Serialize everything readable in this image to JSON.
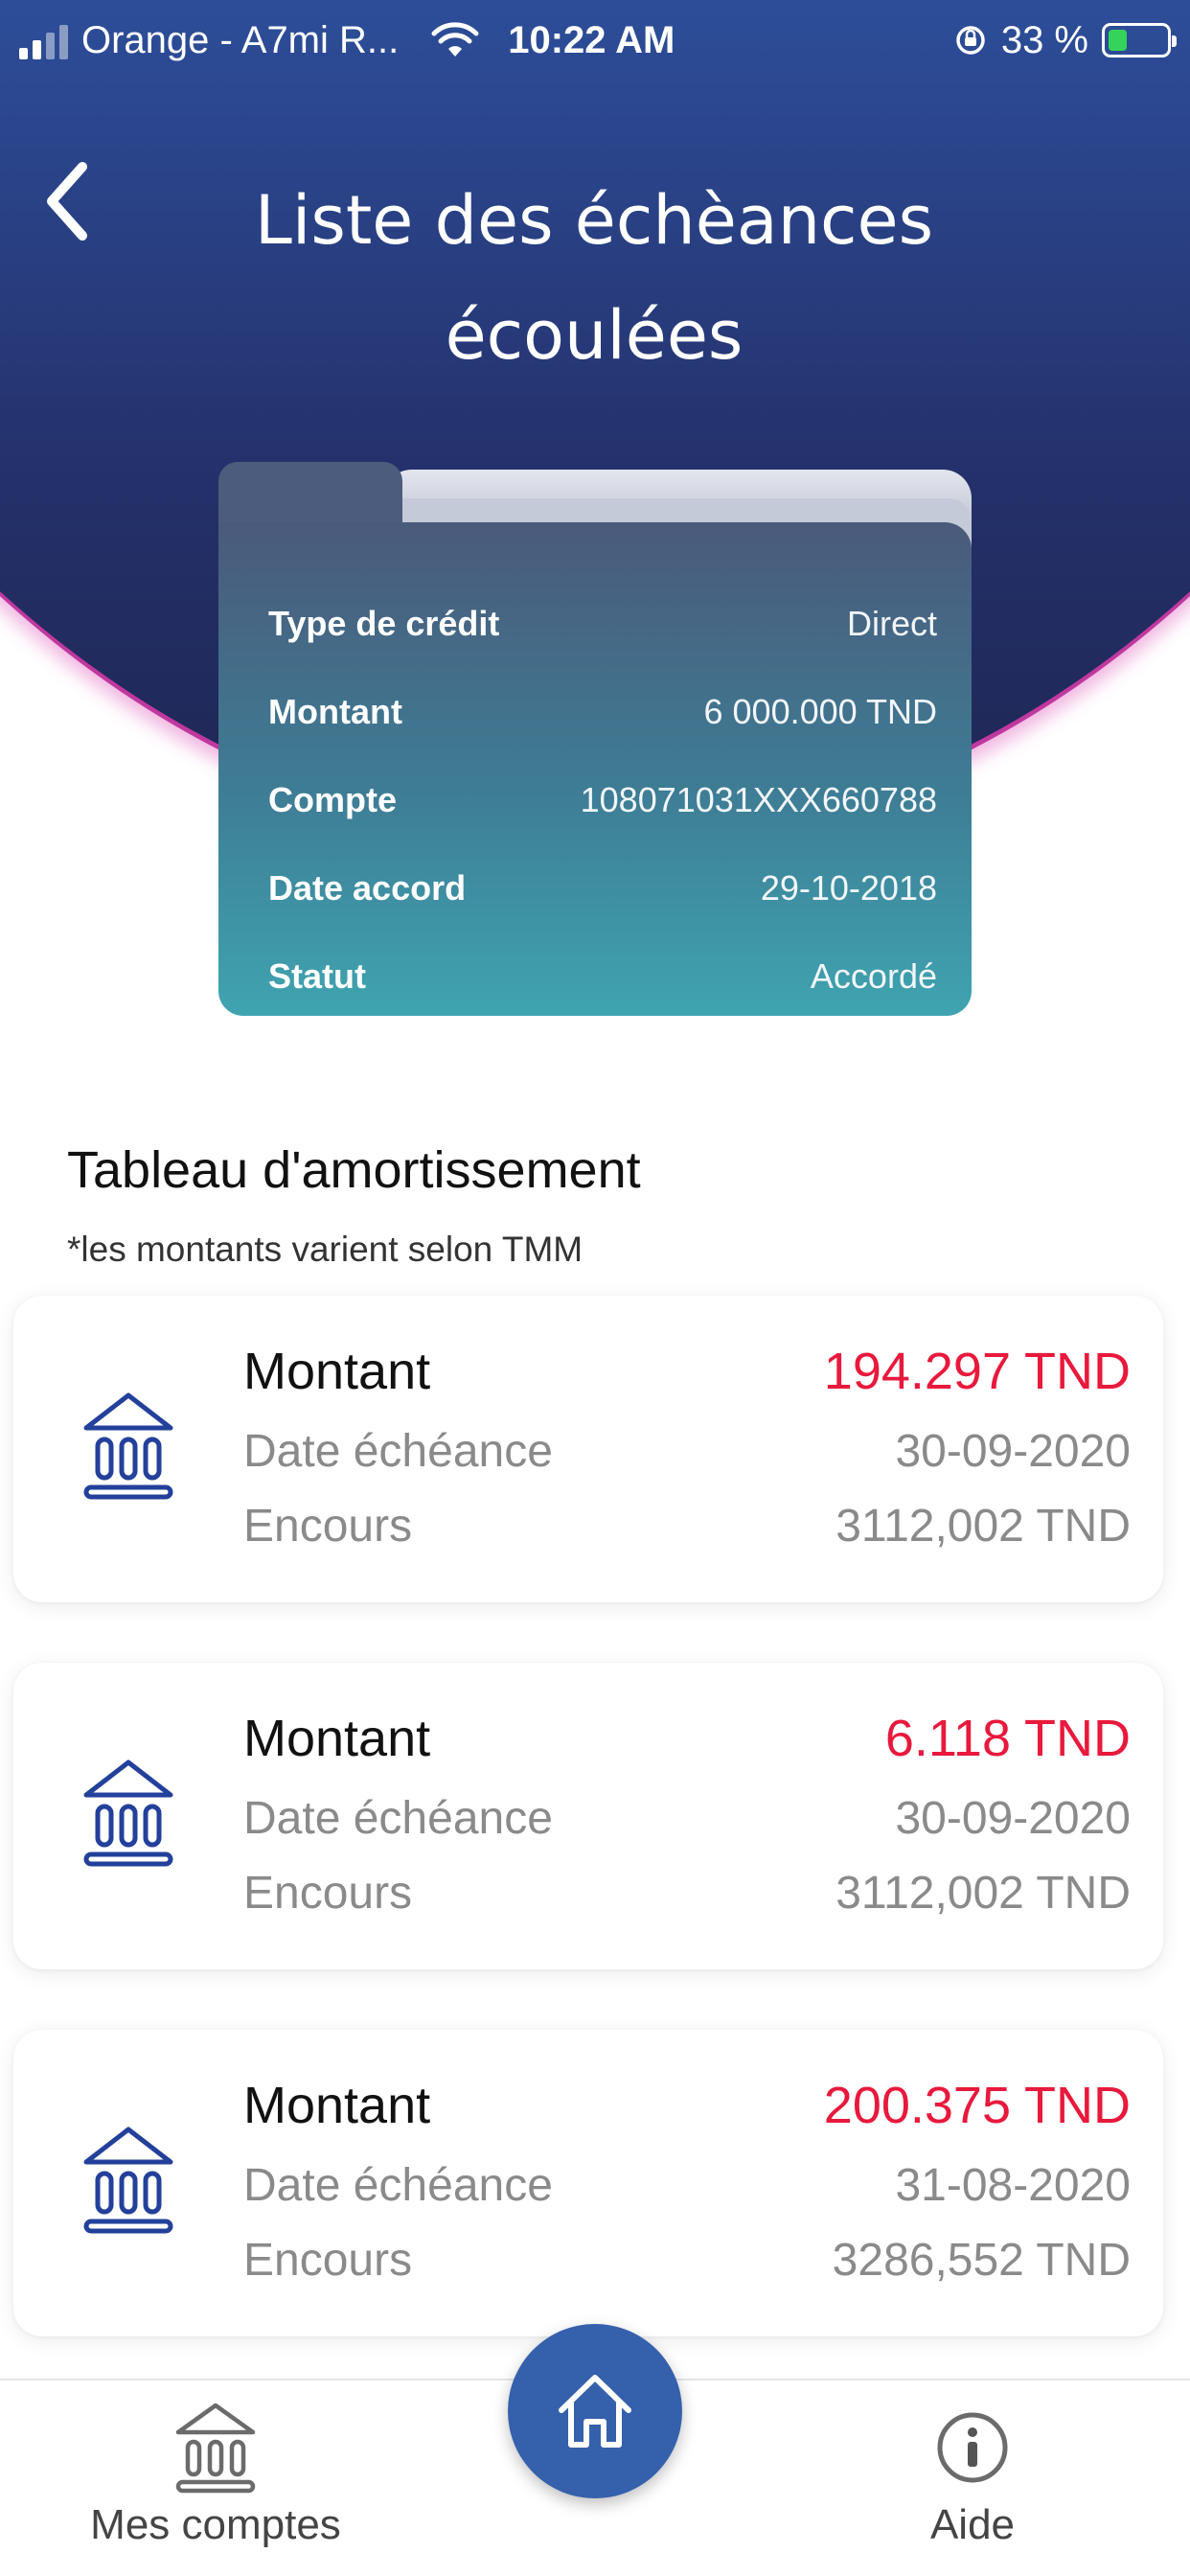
{
  "status_bar": {
    "carrier": "Orange - A7mi R...",
    "time": "10:22 AM",
    "battery": "33 %",
    "battery_level": 0.33
  },
  "header": {
    "title_line1": "Liste des échèances",
    "title_line2": "écoulées",
    "back_icon": "chevron-left-icon"
  },
  "credit_card": {
    "rows": [
      {
        "label": "Type de crédit",
        "value": "Direct"
      },
      {
        "label": "Montant",
        "value": "6 000.000 TND"
      },
      {
        "label": "Compte",
        "value": "108071031XXX660788"
      },
      {
        "label": "Date accord",
        "value": "29-10-2018"
      },
      {
        "label": "Statut",
        "value": "Accordé"
      }
    ]
  },
  "amortization": {
    "title": "Tableau d'amortissement",
    "note": "*les montants varient selon TMM",
    "entries": [
      {
        "amount_label": "Montant",
        "amount": "194.297 TND",
        "date_label": "Date échéance",
        "date": "30-09-2020",
        "balance_label": "Encours",
        "balance": "3112,002 TND"
      },
      {
        "amount_label": "Montant",
        "amount": "6.118 TND",
        "date_label": "Date échéance",
        "date": "30-09-2020",
        "balance_label": "Encours",
        "balance": "3112,002 TND"
      },
      {
        "amount_label": "Montant",
        "amount": "200.375 TND",
        "date_label": "Date échéance",
        "date": "31-08-2020",
        "balance_label": "Encours",
        "balance": "3286,552 TND"
      }
    ]
  },
  "tab_bar": {
    "accounts_label": "Mes comptes",
    "help_label": "Aide",
    "accounts_icon": "bank-icon",
    "home_icon": "home-icon",
    "help_icon": "info-icon"
  },
  "colors": {
    "header_blue": "#2f5aa8",
    "amount_red": "#e8193c",
    "home_button": "#3560ac",
    "card_teal": "#3fa4b0"
  }
}
